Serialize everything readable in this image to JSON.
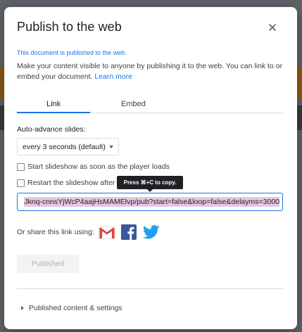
{
  "dialog": {
    "title": "Publish to the web",
    "close_icon": "close-icon",
    "notice": "This document is published to the web.",
    "description": "Make your content visible to anyone by publishing it to the web. You can link to or embed your document.",
    "learn_more": "Learn more",
    "tabs": [
      {
        "label": "Link",
        "selected": true
      },
      {
        "label": "Embed",
        "selected": false
      }
    ],
    "auto_advance": {
      "label": "Auto-advance slides:",
      "selected": "every 3 seconds (default)"
    },
    "checkboxes": [
      {
        "label": "Start slideshow as soon as the player loads",
        "checked": false
      },
      {
        "label": "Restart the slideshow after",
        "checked": false
      }
    ],
    "tooltip": "Press ⌘+C to copy.",
    "url": "Jknq-cnnsYjWcP4aajHsMAMElvp/pub?start=false&loop=false&delayms=3000",
    "share": {
      "label": "Or share this link using:",
      "icons": [
        "gmail-icon",
        "facebook-icon",
        "twitter-icon"
      ]
    },
    "published_button": "Published",
    "expander": "Published content & settings"
  },
  "colors": {
    "accent": "#1a73e8",
    "gmail_red": "#db4437",
    "facebook_blue": "#3b5998",
    "twitter_blue": "#1da1f2",
    "url_highlight": "#e8c6e2"
  }
}
